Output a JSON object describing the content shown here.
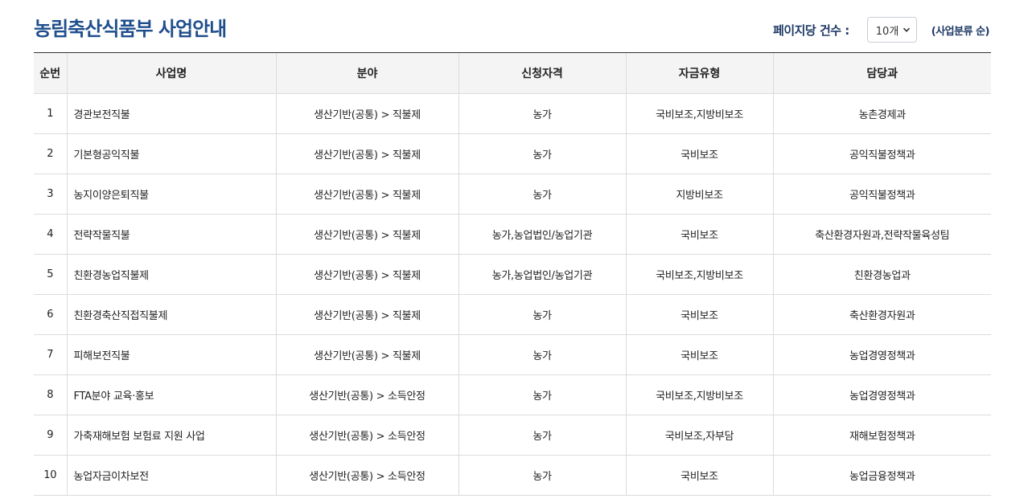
{
  "header": {
    "title": "농림축산식품부 사업안내",
    "per_page_label": "페이지당 건수 :",
    "per_page_value": "10개",
    "sort_label": "(사업분류 순)"
  },
  "table": {
    "columns": [
      "순번",
      "사업명",
      "분야",
      "신청자격",
      "자금유형",
      "담당과"
    ],
    "rows": [
      [
        "1",
        "경관보전직불",
        "생산기반(공통) > 직불제",
        "농가",
        "국비보조,지방비보조",
        "농촌경제과"
      ],
      [
        "2",
        "기본형공익직불",
        "생산기반(공통) > 직불제",
        "농가",
        "국비보조",
        "공익직불정책과"
      ],
      [
        "3",
        "농지이양은퇴직불",
        "생산기반(공통) > 직불제",
        "농가",
        "지방비보조",
        "공익직불정책과"
      ],
      [
        "4",
        "전략작물직불",
        "생산기반(공통) > 직불제",
        "농가,농업법인/농업기관",
        "국비보조",
        "축산환경자원과,전략작물육성팀"
      ],
      [
        "5",
        "친환경농업직불제",
        "생산기반(공통) > 직불제",
        "농가,농업법인/농업기관",
        "국비보조,지방비보조",
        "친환경농업과"
      ],
      [
        "6",
        "친환경축산직접직불제",
        "생산기반(공통) > 직불제",
        "농가",
        "국비보조",
        "축산환경자원과"
      ],
      [
        "7",
        "피해보전직불",
        "생산기반(공통) > 직불제",
        "농가",
        "국비보조",
        "농업경영정책과"
      ],
      [
        "8",
        "FTA분야 교육·홍보",
        "생산기반(공통) > 소득안정",
        "농가",
        "국비보조,지방비보조",
        "농업경영정책과"
      ],
      [
        "9",
        "가축재해보험 보험료 지원 사업",
        "생산기반(공통) > 소득안정",
        "농가",
        "국비보조,자부담",
        "재해보험정책과"
      ],
      [
        "10",
        "농업자금이차보전",
        "생산기반(공통) > 소득안정",
        "농가",
        "국비보조",
        "농업금융정책과"
      ]
    ]
  }
}
